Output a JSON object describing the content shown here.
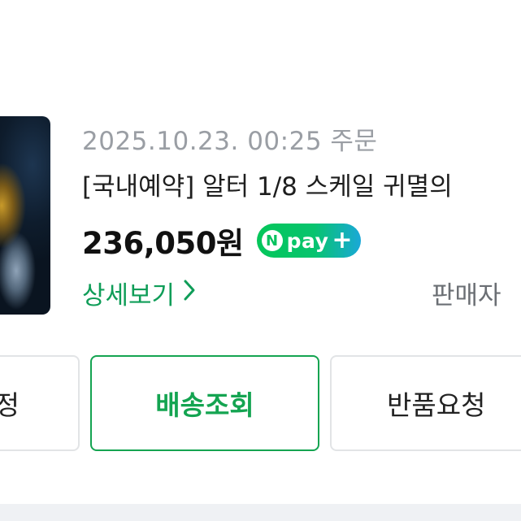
{
  "order": {
    "date": "2025.10.23. 00:25 주문",
    "title": "[국내예약] 알터 1/8 스케일 귀멸의",
    "price": "236,050원",
    "npay": {
      "n": "N",
      "pay": "pay",
      "plus": "+"
    },
    "detail_link": "상세보기",
    "seller_link": "판매자"
  },
  "actions": {
    "left_partial": "정",
    "track": "배송조회",
    "return": "반품요청"
  },
  "colors": {
    "accent_green": "#14a451",
    "npay_green": "#05c65a",
    "muted_text": "#9a9ea4"
  }
}
